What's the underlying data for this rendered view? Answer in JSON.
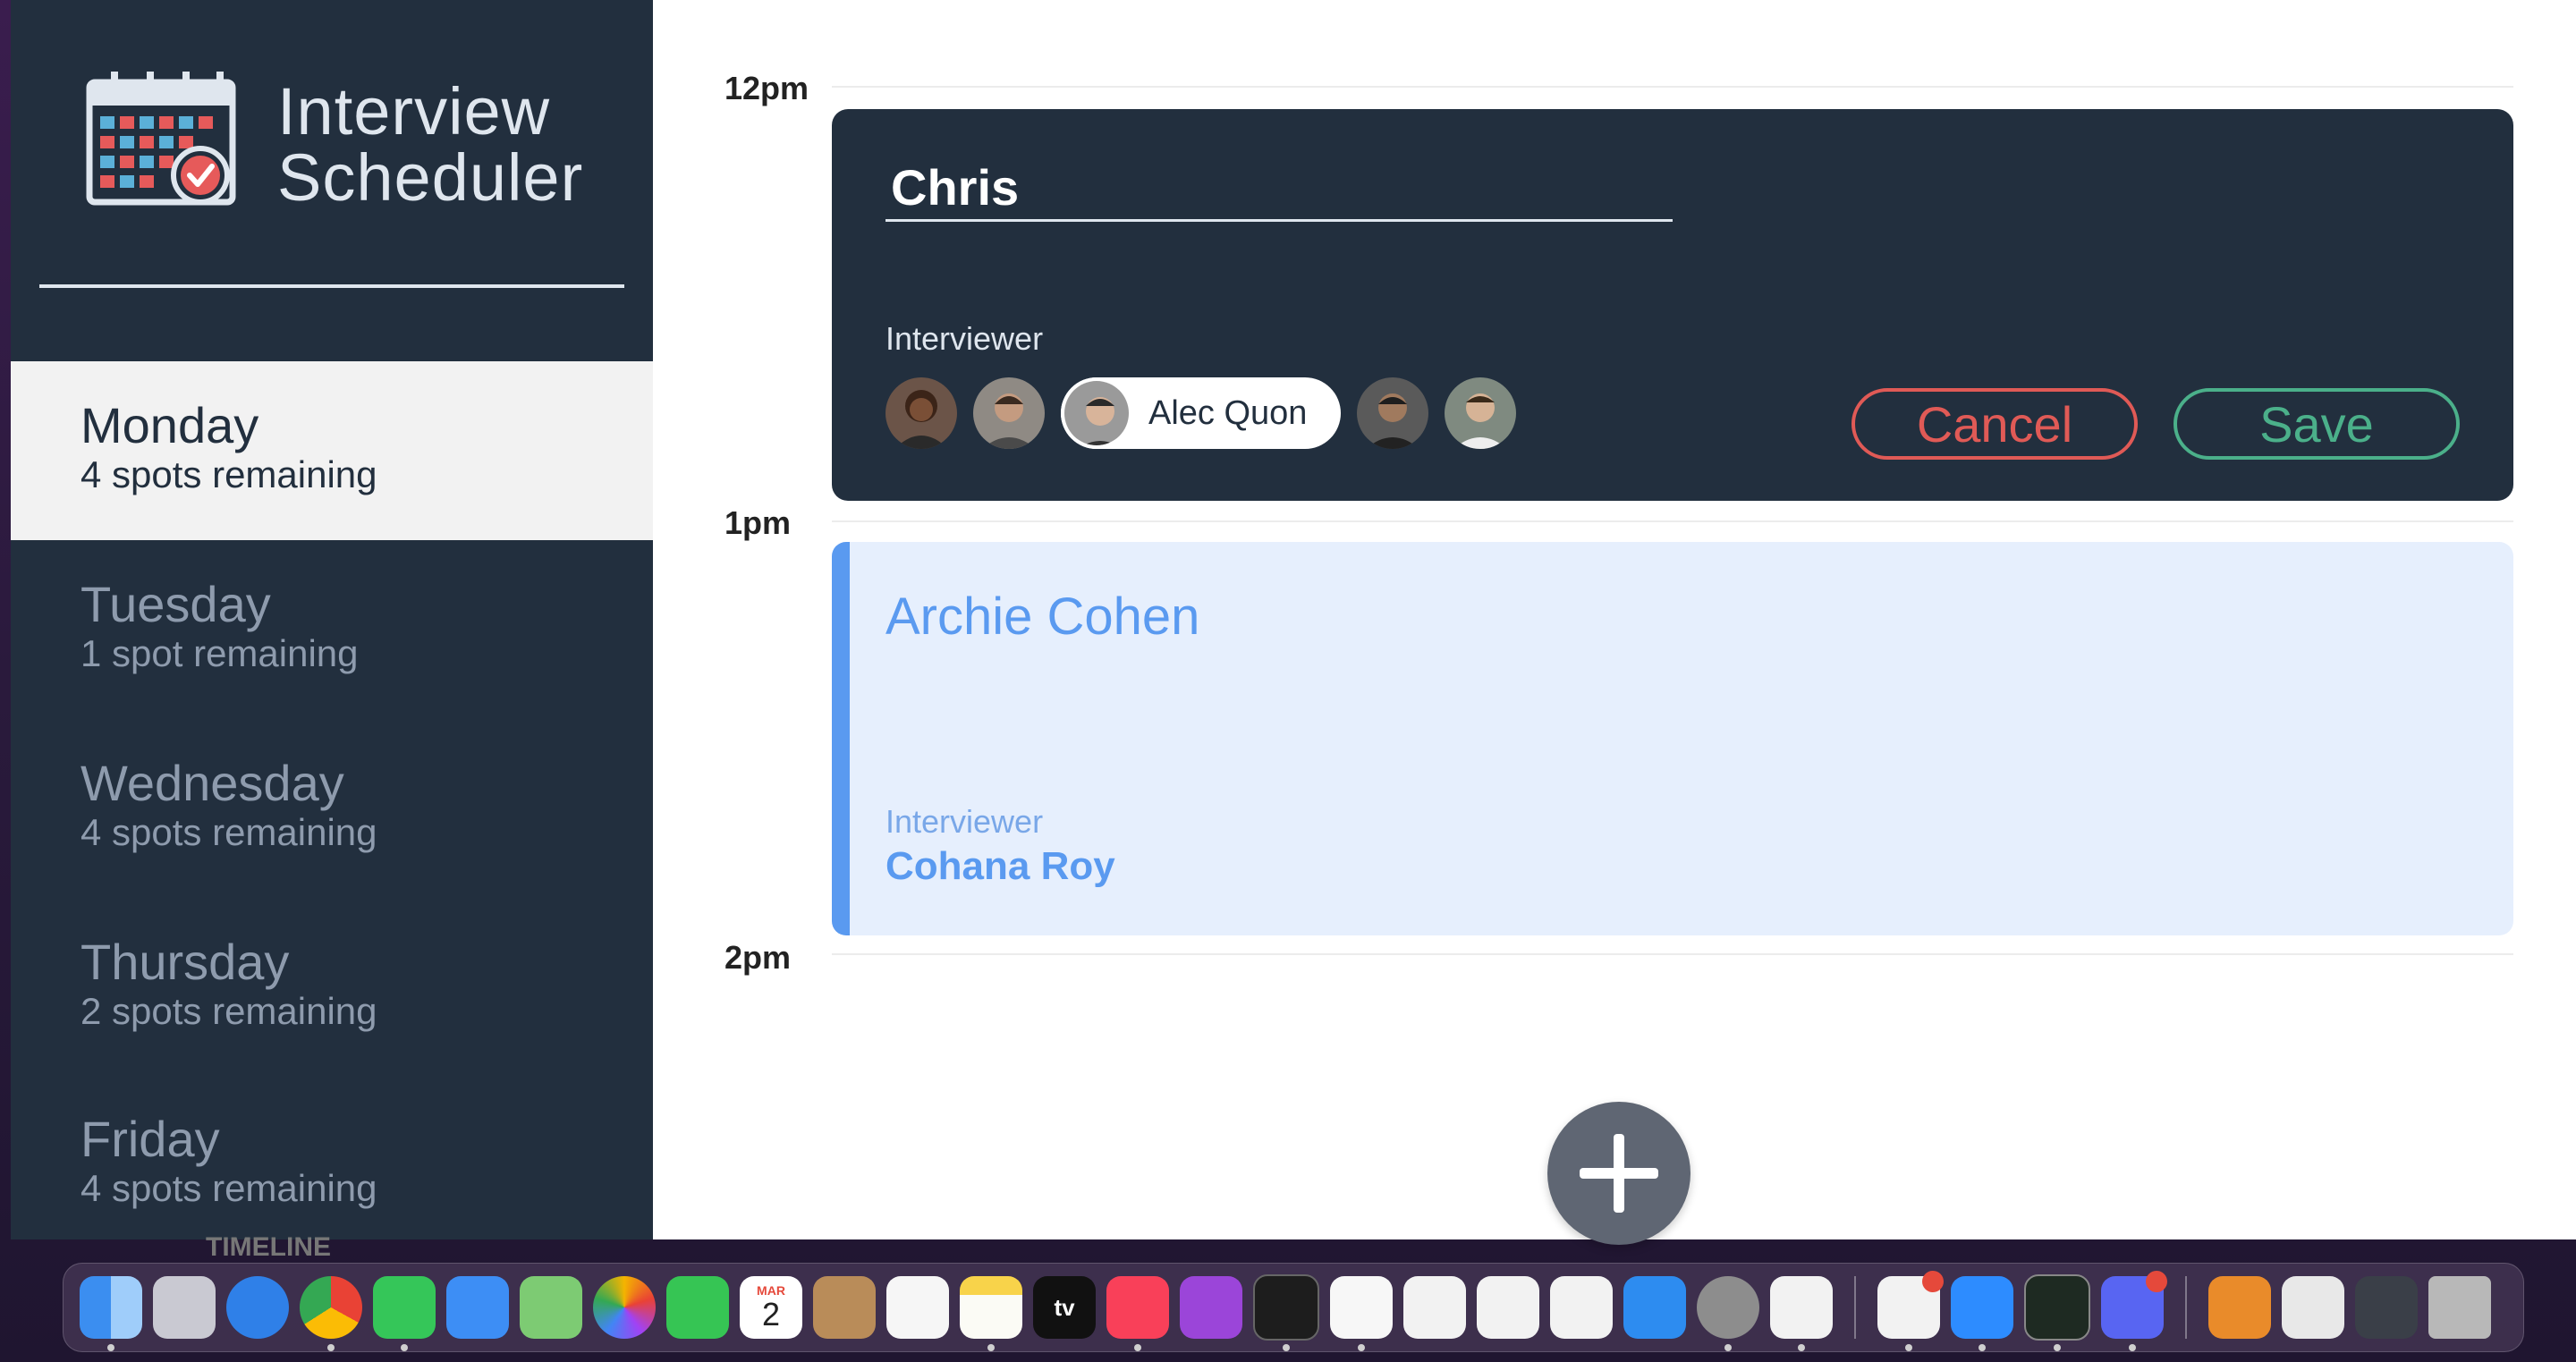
{
  "app": {
    "brand_line1": "Interview",
    "brand_line2": "Scheduler"
  },
  "days": [
    {
      "name": "Monday",
      "spots": "4 spots remaining",
      "selected": true
    },
    {
      "name": "Tuesday",
      "spots": "1 spot remaining",
      "selected": false
    },
    {
      "name": "Wednesday",
      "spots": "4 spots remaining",
      "selected": false
    },
    {
      "name": "Thursday",
      "spots": "2 spots remaining",
      "selected": false
    },
    {
      "name": "Friday",
      "spots": "4 spots remaining",
      "selected": false
    }
  ],
  "timeline_peek": "TIMELINE",
  "hours": [
    "12pm",
    "1pm",
    "2pm"
  ],
  "edit_form": {
    "student_value": "Chris",
    "interviewer_label": "Interviewer",
    "selected_interviewer": "Alec Quon",
    "cancel_label": "Cancel",
    "save_label": "Save"
  },
  "appointment": {
    "student": "Archie Cohen",
    "interviewer_label": "Interviewer",
    "interviewer": "Cohana Roy"
  },
  "colors": {
    "sidebar_bg": "#222f3e",
    "accent_blue": "#5a9af0",
    "cancel_red": "#e05a56",
    "save_green": "#4bb08a"
  },
  "dock_icons": [
    "finder-icon",
    "launchpad-icon",
    "safari-icon",
    "chrome-icon",
    "messages-icon",
    "mail-icon",
    "maps-icon",
    "photos-icon",
    "facetime-icon",
    "calendar-icon",
    "contacts-icon",
    "reminders-icon",
    "notes-icon",
    "tv-icon",
    "music-icon",
    "podcasts-icon",
    "terminal-icon",
    "news-icon",
    "keynote-icon",
    "numbers-icon",
    "pages-icon",
    "app-store-icon",
    "system-settings-icon",
    "vscode-icon",
    "slack-icon",
    "zoom-icon",
    "activity-monitor-icon",
    "discord-icon",
    "sourcetree-icon",
    "preview-icon",
    "desktop-icon",
    "trash-icon"
  ],
  "dock_text": {
    "calendar_month": "MAR",
    "calendar_day": "2",
    "tv": "tv"
  }
}
